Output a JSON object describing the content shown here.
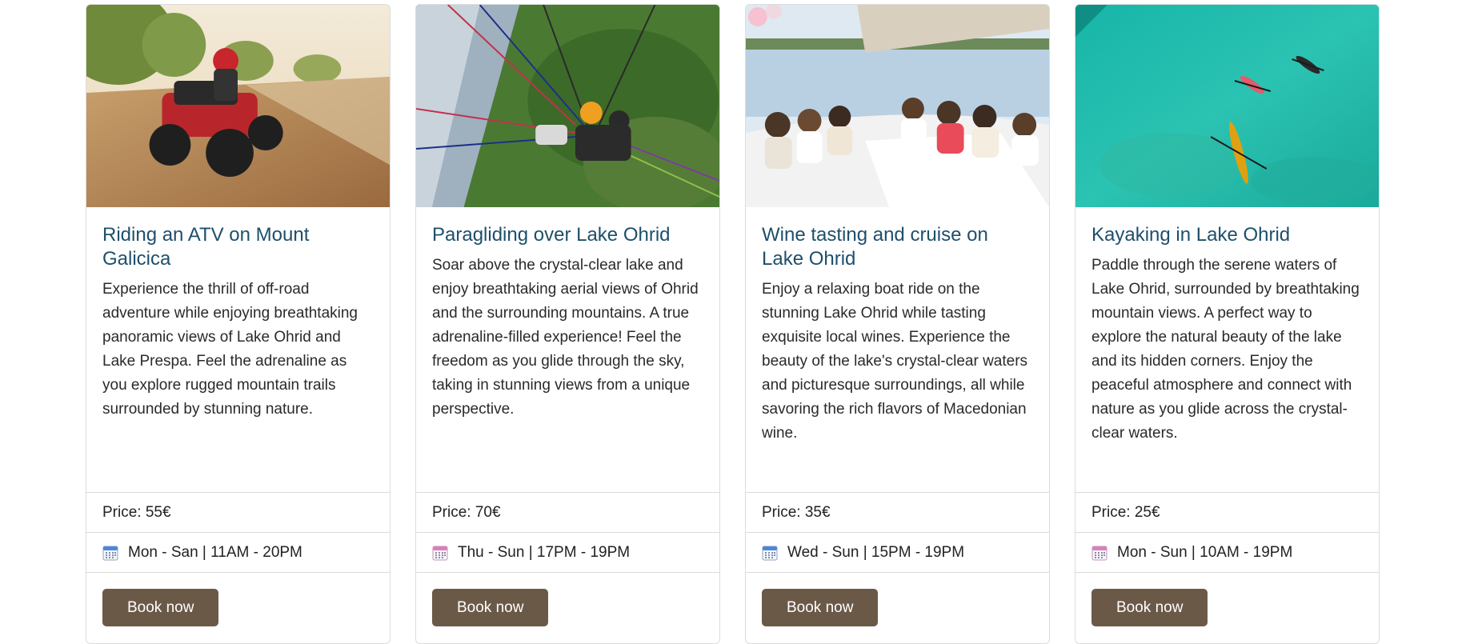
{
  "cards": [
    {
      "title": "Riding an ATV on Mount Galicica",
      "description": "Experience the thrill of off-road adventure while enjoying breathtaking panoramic views of Lake Ohrid and Lake Prespa. Feel the adrenaline as you explore rugged mountain trails surrounded by stunning nature.",
      "price": "Price: 55€",
      "schedule": "Mon - San | 11AM - 20PM",
      "button": "Book now",
      "image": "atv-photo",
      "icon": "calendar-icon"
    },
    {
      "title": "Paragliding over Lake Ohrid",
      "description": "Soar above the crystal-clear lake and enjoy breathtaking aerial views of Ohrid and the surrounding mountains. A true adrenaline-filled experience! Feel the freedom as you glide through the sky, taking in stunning views from a unique perspective.",
      "price": "Price: 70€",
      "schedule": "Thu - Sun | 17PM - 19PM",
      "button": "Book now",
      "image": "paragliding-photo",
      "icon": "calendar-icon"
    },
    {
      "title": "Wine tasting and cruise on Lake Ohrid",
      "description": "Enjoy a relaxing boat ride on the stunning Lake Ohrid while tasting exquisite local wines. Experience the beauty of the lake's crystal-clear waters and picturesque surroundings, all while savoring the rich flavors of Macedonian wine.",
      "price": "Price: 35€",
      "schedule": "Wed - Sun | 15PM - 19PM",
      "button": "Book now",
      "image": "boat-cruise-photo",
      "icon": "calendar-icon"
    },
    {
      "title": "Kayaking in Lake Ohrid",
      "description": "Paddle through the serene waters of Lake Ohrid, surrounded by breathtaking mountain views. A perfect way to explore the natural beauty of the lake and its hidden corners. Enjoy the peaceful atmosphere and connect with nature as you glide across the crystal-clear waters.",
      "price": "Price: 25€",
      "schedule": "Mon - Sun | 10AM - 19PM",
      "button": "Book now",
      "image": "kayak-photo",
      "icon": "calendar-icon"
    }
  ],
  "colors": {
    "title": "#1e4f6b",
    "button_bg": "#6b5948",
    "border": "#dcdcdc"
  }
}
